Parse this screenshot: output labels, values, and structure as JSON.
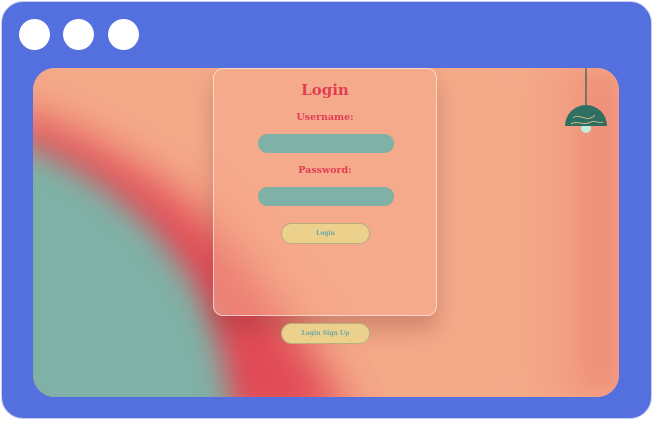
{
  "window": {
    "controls": [
      "window-dot-1",
      "window-dot-2",
      "window-dot-3"
    ]
  },
  "login_card": {
    "title": "Login",
    "username_label": "Username:",
    "username_value": "",
    "password_label": "Password:",
    "password_value": "",
    "login_button": "Login"
  },
  "signup_button": "Login Sign Up",
  "decor": {
    "lamp_icon": "pendant-lamp-icon"
  },
  "colors": {
    "frame": "#5470de",
    "accent_red": "#e23d52",
    "teal": "#7fb1a6",
    "peach": "#f3a888",
    "button_yellow": "#ecd18d"
  }
}
